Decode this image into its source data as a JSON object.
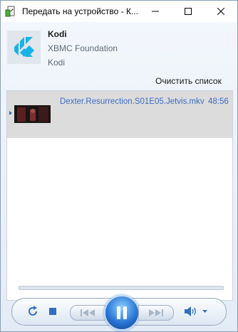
{
  "window": {
    "title": "Передать на устройство - К...",
    "icon": "cast-to-device-icon",
    "buttons": [
      "minimize-icon",
      "maximize-icon",
      "close-icon"
    ]
  },
  "media": {
    "title": "Kodi",
    "artist": "XBMC Foundation",
    "album": "Kodi",
    "album_art": "kodi-logo"
  },
  "actions": {
    "clear_list": "Очистить список"
  },
  "playlist": [
    {
      "name": "Dexter.Resurrection.S01E05.Jetvis.mkv",
      "duration": "48:56",
      "now_playing": true
    }
  ],
  "controls": {
    "repeat": "repeat-icon",
    "stop": "stop-icon",
    "previous": "previous-icon",
    "play_state": "pause-icon",
    "next": "next-icon",
    "volume": "volume-icon"
  },
  "colors": {
    "accent": "#3c6cc4",
    "selected_row": "#dcdcdc",
    "kodi_blue": "#17b2e7"
  }
}
